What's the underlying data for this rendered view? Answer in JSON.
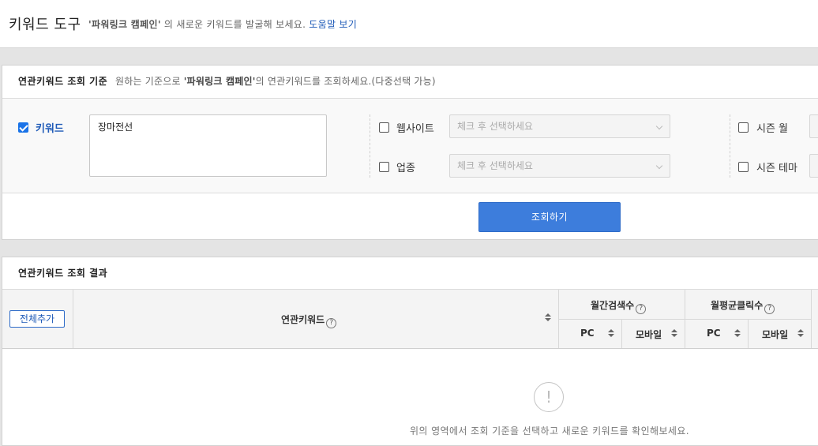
{
  "header": {
    "title": "키워드 도구",
    "desc_quote": "'파워링크 캠페인'",
    "desc_rest": " 의 새로운 키워드를 발굴해 보세요.",
    "help_link": "도움말 보기"
  },
  "criteria": {
    "title": "연관키워드 조회 기준",
    "sub_prefix": "원하는 기준으로",
    "sub_quote": "'파워링크 캠페인'",
    "sub_suffix": "의 연관키워드를 조회하세요.(다중선택 가능)",
    "keyword_label": "키워드",
    "keyword_checked": true,
    "keyword_value": "장마전선",
    "website_label": "웹사이트",
    "website_placeholder": "체크 후 선택하세요",
    "industry_label": "업종",
    "industry_placeholder": "체크 후 선택하세요",
    "season_month_label": "시즌 월",
    "season_theme_label": "시즌 테마",
    "search_button": "조회하기"
  },
  "results": {
    "title": "연관키워드 조회 결과",
    "add_all_button": "전체추가",
    "col_keyword": "연관키워드",
    "col_monthly_search": "월간검색수",
    "col_monthly_click": "월평균클릭수",
    "sub_pc": "PC",
    "sub_mobile": "모바일",
    "help_glyph": "?",
    "empty_glyph": "!",
    "empty_message": "위의 영역에서 조회 기준을 선택하고 새로운 키워드를 확인해보세요."
  }
}
